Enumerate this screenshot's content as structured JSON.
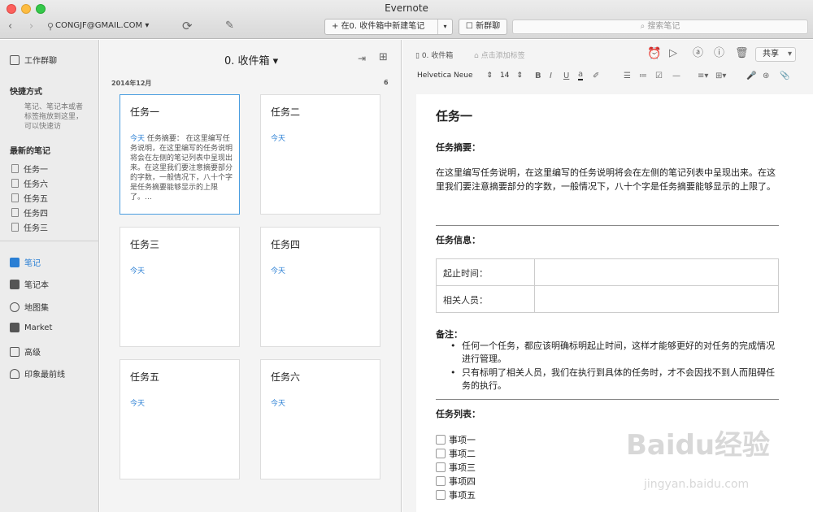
{
  "window": {
    "title": "Evernote"
  },
  "toolbar": {
    "account": "CONGJF@GMAIL.COM ▾",
    "new_note": "在0. 收件箱中新建笔记",
    "new_chat": "新群聊",
    "search_placeholder": "搜索笔记"
  },
  "sidebar": {
    "work_chat": "工作群聊",
    "shortcuts_head": "快捷方式",
    "shortcuts_hint": "笔记、笔记本或者标签拖放到这里，可以快速访",
    "recent_head": "最新的笔记",
    "recent": [
      "任务一",
      "任务六",
      "任务五",
      "任务四",
      "任务三"
    ],
    "nav": [
      {
        "label": "笔记",
        "icon": "note-icon",
        "active": true
      },
      {
        "label": "笔记本",
        "icon": "notebook-icon"
      },
      {
        "label": "地图集",
        "icon": "atlas-icon"
      },
      {
        "label": "Market",
        "icon": "market-icon"
      },
      {
        "label": "高级",
        "icon": "premium-icon"
      },
      {
        "label": "印象最前线",
        "icon": "elephant-icon"
      }
    ]
  },
  "notelist": {
    "title": "0. 收件箱 ▾",
    "month": "2014年12月",
    "count": "6",
    "cards": [
      {
        "title": "任务一",
        "date": "今天",
        "snippet": " 任务摘要： 在这里编写任务说明，在这里编写的任务说明将会在左侧的笔记列表中呈现出来。在这里我们要注意摘要部分的字数，一般情况下，八十个字是任务摘要能够显示的上限了。…"
      },
      {
        "title": "任务二",
        "date": "今天",
        "snippet": ""
      },
      {
        "title": "任务三",
        "date": "今天",
        "snippet": ""
      },
      {
        "title": "任务四",
        "date": "今天",
        "snippet": ""
      },
      {
        "title": "任务五",
        "date": "今天",
        "snippet": ""
      },
      {
        "title": "任务六",
        "date": "今天",
        "snippet": ""
      }
    ]
  },
  "editor": {
    "notebook": "0. 收件箱",
    "add_tag": "点击添加标签",
    "share": "共享",
    "font": "Helvetica Neue",
    "font_size": "14",
    "title": "任务一",
    "summary_label": "任务摘要：",
    "summary_text": "在这里编写任务说明，在这里编写的任务说明将会在左侧的笔记列表中呈现出来。在这里我们要注意摘要部分的字数，一般情况下，八十个字是任务摘要能够显示的上限了。",
    "info_label": "任务信息：",
    "table": [
      "起止时间：",
      "相关人员："
    ],
    "remark_label": "备注：",
    "bullets": [
      "任何一个任务，都应该明确标明起止时间，这样才能够更好的对任务的完成情况进行管理。",
      "只有标明了相关人员，我们在执行到具体的任务时，才不会因找不到人而阻碍任务的执行。"
    ],
    "list_label": "任务列表：",
    "checklist": [
      "事项一",
      "事项二",
      "事项三",
      "事项四",
      "事项五"
    ]
  },
  "watermark": {
    "brand": "Baidu经验",
    "url": "jingyan.baidu.com"
  },
  "colors": {
    "accent": "#2a7fd4",
    "selected_border": "#4a9ee0"
  }
}
